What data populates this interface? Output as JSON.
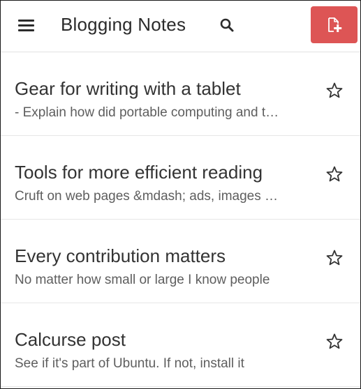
{
  "header": {
    "title": "Blogging Notes",
    "menu_icon": "hamburger-menu-icon",
    "search_icon": "search-icon",
    "new_note_icon": "new-document-icon",
    "accent_color": "#dd5555"
  },
  "notes": [
    {
      "title": "Gear for writing with a tablet",
      "snippet": "- Explain how did portable computing and tablets evolve",
      "starred": false
    },
    {
      "title": "Tools for more efficient reading",
      "snippet": "Cruft on web pages &mdash; ads, images and popups",
      "starred": false
    },
    {
      "title": "Every contribution matters",
      "snippet": "No matter how small or large I know people",
      "starred": false
    },
    {
      "title": "Calcurse post",
      "snippet": "See if it's part of Ubuntu. If not, install it",
      "starred": false
    }
  ]
}
